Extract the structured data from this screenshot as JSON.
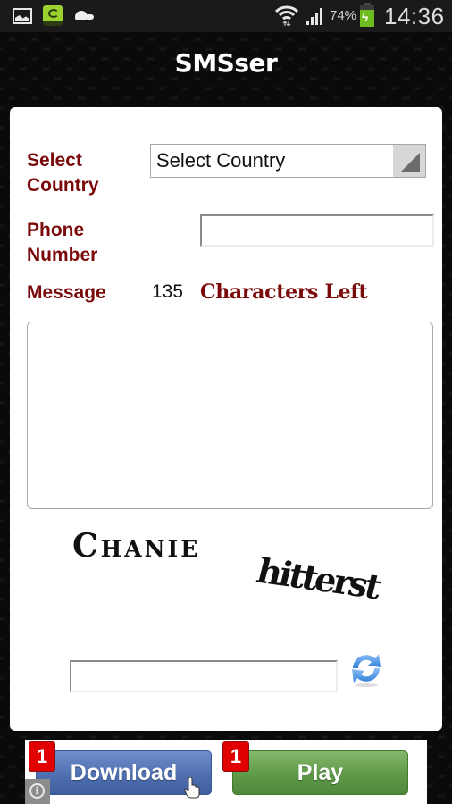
{
  "status_bar": {
    "notification_icons": [
      "gallery-icon",
      "sync-drive-icon",
      "turtle-icon"
    ],
    "wifi_icon": "wifi-icon",
    "signal_icon": "signal-icon",
    "battery_percent": "74%",
    "battery_icon": "battery-charging-icon",
    "time": "14:36"
  },
  "app": {
    "title": "SMSser"
  },
  "form": {
    "country": {
      "label_line1": "Select",
      "label_line2": "Country",
      "selected_value": "Select Country"
    },
    "phone": {
      "label_line1": "Phone",
      "label_line2": "Number",
      "value": "",
      "placeholder": ""
    },
    "message": {
      "label": "Message",
      "chars_left_count": "135",
      "chars_left_text": "Characters Left",
      "value": ""
    },
    "captcha": {
      "word1": "Chanie",
      "word2": "hitterst",
      "input_value": "",
      "refresh_icon": "refresh-icon"
    }
  },
  "ad_banner": {
    "download_label": "Download",
    "download_badge": "1",
    "play_label": "Play",
    "play_badge": "1",
    "info_icon": "info-icon",
    "colors": {
      "download": "#4f6fb0",
      "play": "#5e9a48",
      "badge": "#e00000"
    }
  },
  "theme": {
    "label_color": "#7a0a0a",
    "card_bg": "#ffffff"
  }
}
